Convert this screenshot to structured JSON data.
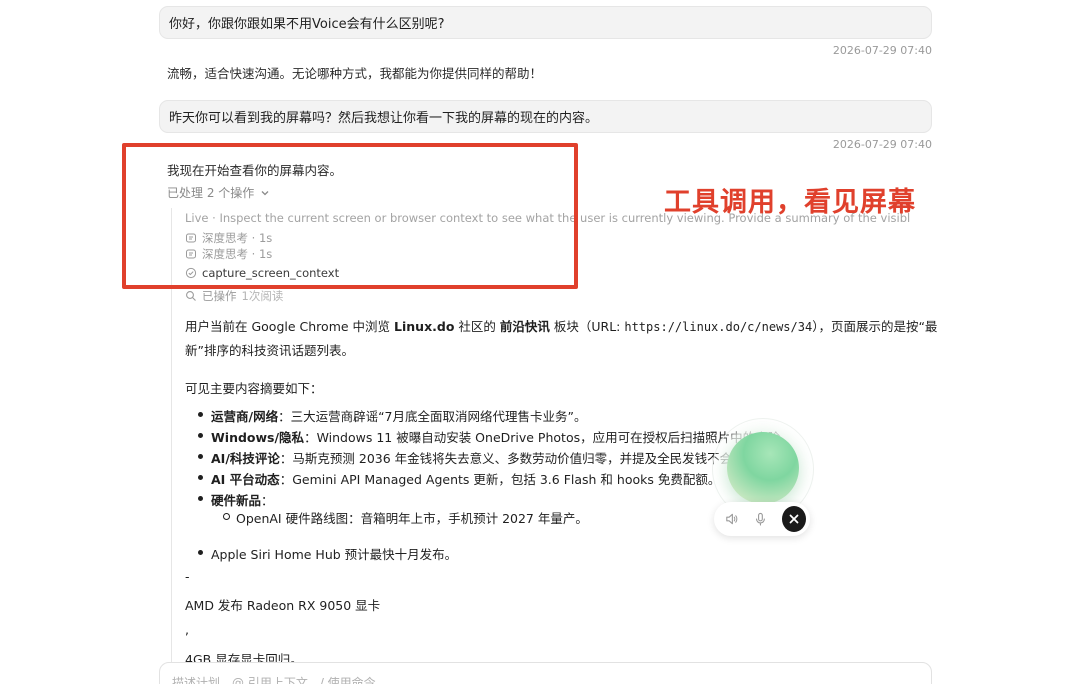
{
  "messages": {
    "user1": "你好，你跟你跟如果不用Voice会有什么区别呢?",
    "ts1": "2026-07-29 07:40",
    "reply1": "流畅，适合快速沟通。无论哪种方式，我都能为你提供同样的帮助！",
    "user2": "昨天你可以看到我的屏幕吗？然后我想让你看一下我的屏幕的现在的内容。",
    "ts2": "2026-07-29 07:40",
    "reply2_intro": "我现在开始查看你的屏幕内容。"
  },
  "ops": {
    "toggle_label": "已处理 2 个操作",
    "live": "Live · Inspect the current screen or browser context to see what the user is currently viewing. Provide a summary of the visibl",
    "think1": "深度思考 · 1s",
    "think2": "深度思考 · 1s",
    "tool": "capture_screen_context",
    "done_label": "已操作",
    "done_detail": "1次阅读"
  },
  "annotation": {
    "label": "工具调用，看见屏幕",
    "color": "#e0402c"
  },
  "summary": {
    "p1_a": "用户当前在 Google Chrome 中浏览 ",
    "p1_b": "Linux.do",
    "p1_c": " 社区的 ",
    "p1_d": "前沿快讯",
    "p1_e": " 板块（URL: ",
    "p1_url": "https://linux.do/c/news/34",
    "p1_f": "），页面展示的是按“最",
    "p1_g": "新”排序的科技资讯话题列表。",
    "p2": "可见主要内容摘要如下：",
    "bullets": [
      {
        "label": "运营商/网络",
        "text": "：三大运营商辟谣“7月底全面取消网络代理售卡业务”。"
      },
      {
        "label": "Windows/隐私",
        "text": "：Windows 11 被曝自动安装 OneDrive Photos，应用可在授权后扫描照片中的人脸"
      },
      {
        "label": "AI/科技评论",
        "text": "：马斯克预测 2036 年金钱将失去意义、多数劳动价值归零，并提及全民发钱不会"
      },
      {
        "label": "AI 平台动态",
        "text": "：Gemini API Managed Agents 更新，包括 3.6 Flash 和 hooks 免费配额。"
      },
      {
        "label": "硬件新品",
        "text": "："
      }
    ],
    "sub_bullet": "OpenAI 硬件路线图：音箱明年上市，手机预计 2027 年量产。",
    "bullet_siri": "Apple Siri Home Hub 预计最快十月发布。",
    "dash": "-",
    "amd": "AMD 发布 Radeon RX 9050 显卡",
    "comma": ",",
    "gpu": "4GB 显存显卡回归。"
  },
  "input": {
    "placeholder": "描述计划，@ 引用上下文，/ 使用命令"
  },
  "voice": {
    "icons": [
      "speaker-icon",
      "microphone-icon",
      "close-icon"
    ]
  }
}
